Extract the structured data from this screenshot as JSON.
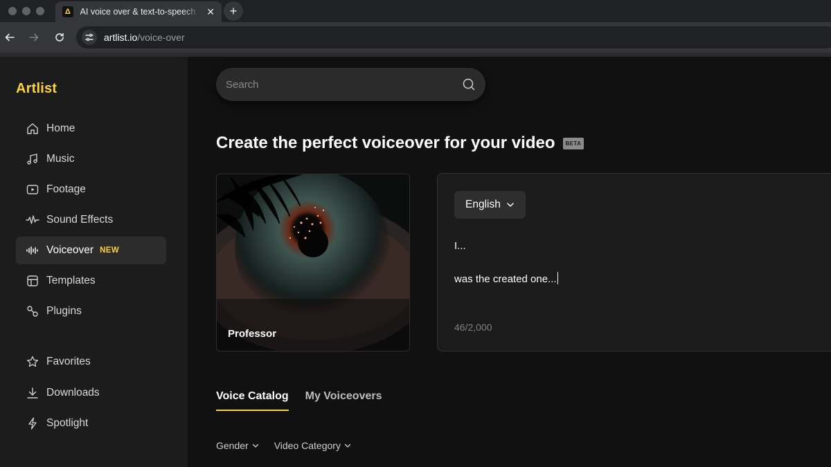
{
  "browser": {
    "tab_title": "AI voice over & text-to-speech",
    "new_tab_symbol": "+",
    "tab_close_symbol": "✕",
    "url_host": "artlist.io",
    "url_path": "/voice-over"
  },
  "sidebar": {
    "logo": "Artlist",
    "items": [
      {
        "label": "Home",
        "icon": "home-icon"
      },
      {
        "label": "Music",
        "icon": "music-icon"
      },
      {
        "label": "Footage",
        "icon": "footage-icon"
      },
      {
        "label": "Sound Effects",
        "icon": "waveform-icon"
      },
      {
        "label": "Voiceover",
        "icon": "voiceover-icon",
        "badge": "NEW",
        "active": true
      },
      {
        "label": "Templates",
        "icon": "templates-icon"
      },
      {
        "label": "Plugins",
        "icon": "plugins-icon"
      },
      {
        "label": "Favorites",
        "icon": "star-icon"
      },
      {
        "label": "Downloads",
        "icon": "download-icon"
      },
      {
        "label": "Spotlight",
        "icon": "lightning-icon"
      }
    ]
  },
  "main": {
    "search_placeholder": "Search",
    "headline": "Create the perfect voiceover for your video",
    "beta_badge": "BETA",
    "voice_card": {
      "name": "Professor"
    },
    "editor": {
      "language": "English",
      "line1": "I...",
      "line2": "was the created one...",
      "counter": "46/2,000"
    },
    "tabs": [
      {
        "label": "Voice Catalog",
        "active": true
      },
      {
        "label": "My Voiceovers",
        "active": false
      }
    ],
    "filters": [
      {
        "label": "Gender"
      },
      {
        "label": "Video Category"
      }
    ]
  },
  "colors": {
    "accent": "#ffd23f",
    "background": "#111111",
    "sidebar": "#1c1c1c"
  }
}
